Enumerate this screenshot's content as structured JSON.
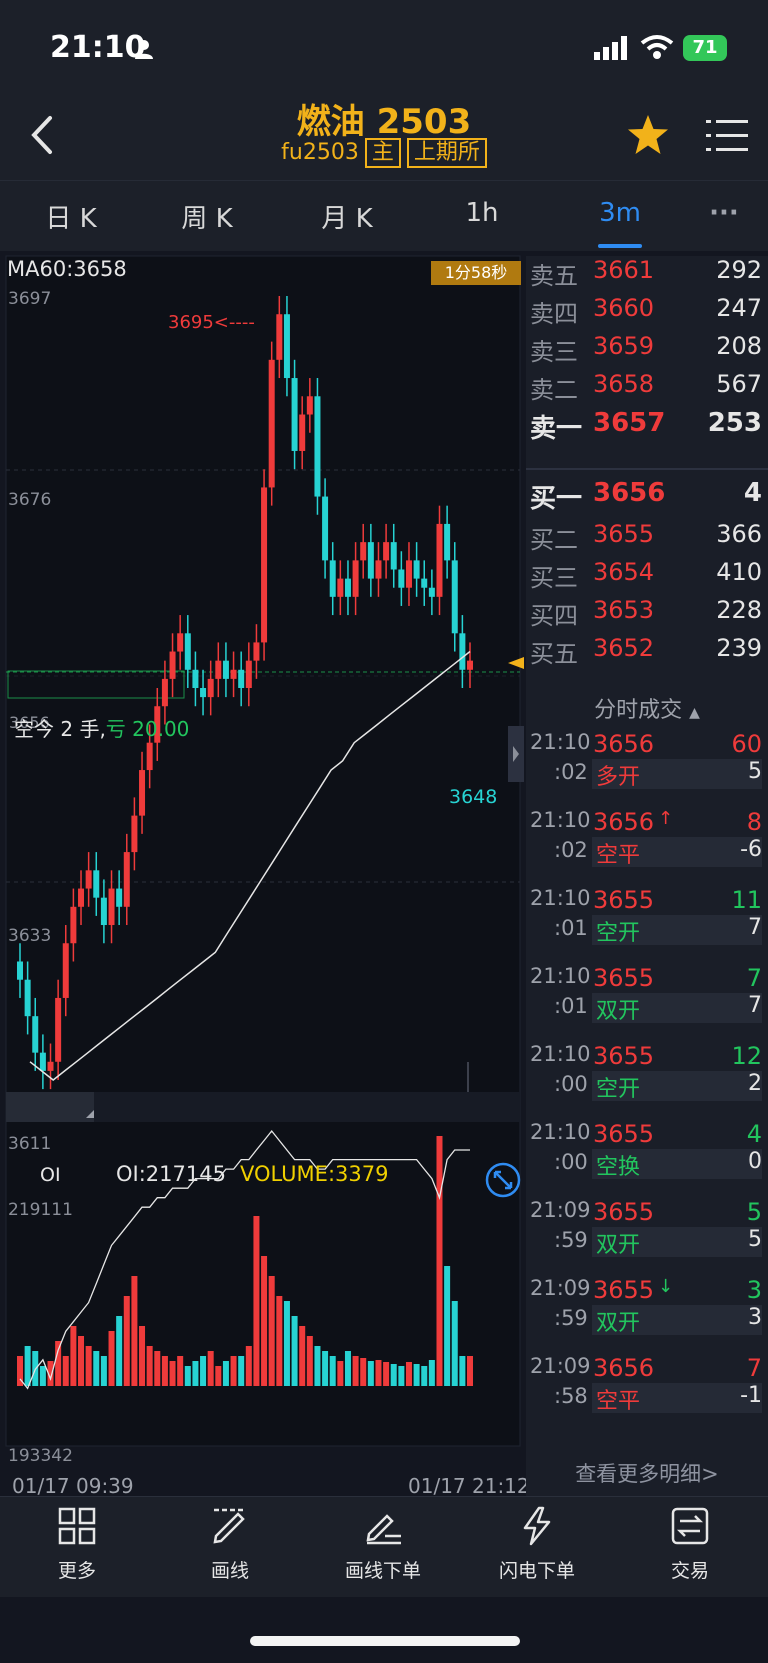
{
  "status": {
    "time": "21:10",
    "battery": "71"
  },
  "header": {
    "title": "燃油 2503",
    "code": "fu2503",
    "tag_main": "主",
    "tag_exchange": "上期所"
  },
  "tabs": [
    {
      "label": "日 K",
      "active": false
    },
    {
      "label": "周 K",
      "active": false
    },
    {
      "label": "月 K",
      "active": false
    },
    {
      "label": "1h",
      "active": false
    },
    {
      "label": "3m",
      "active": true
    },
    {
      "label": "···",
      "active": false
    }
  ],
  "chart": {
    "ma_label": "MA60:3658",
    "countdown": "1分58秒",
    "axis_labels": [
      "3697",
      "3676",
      "3633",
      "3611"
    ],
    "max_marker": "3695<----",
    "min_marker": "3648",
    "position_label": "空今 2 手,",
    "position_pnl": "亏 20.00",
    "position_price": "3656",
    "indicator_tab": "OI",
    "oi_value": "OI:217145",
    "volume_value": "VOLUME:3379",
    "sub_axis_top": "219111",
    "sub_axis_bottom": "193342",
    "date_start": "01/17 09:39",
    "date_end": "01/17 21:12"
  },
  "chart_data": {
    "type": "candlestick",
    "ma_period": 60,
    "ma_value": 3658,
    "y_ticks": [
      3697,
      3676,
      3633,
      3611
    ],
    "high": 3695,
    "low": 3648,
    "last": 3656,
    "oi": 217145,
    "volume": 3379,
    "oi_range": [
      193342,
      219111
    ]
  },
  "orderbook": {
    "asks": [
      {
        "label": "卖五",
        "price": "3661",
        "vol": "292"
      },
      {
        "label": "卖四",
        "price": "3660",
        "vol": "247"
      },
      {
        "label": "卖三",
        "price": "3659",
        "vol": "208"
      },
      {
        "label": "卖二",
        "price": "3658",
        "vol": "567"
      },
      {
        "label": "卖一",
        "price": "3657",
        "vol": "253"
      }
    ],
    "bids": [
      {
        "label": "买一",
        "price": "3656",
        "vol": "4"
      },
      {
        "label": "买二",
        "price": "3655",
        "vol": "366"
      },
      {
        "label": "买三",
        "price": "3654",
        "vol": "410"
      },
      {
        "label": "买四",
        "price": "3653",
        "vol": "228"
      },
      {
        "label": "买五",
        "price": "3652",
        "vol": "239"
      }
    ]
  },
  "ticks_header": "分时成交",
  "ticks": [
    {
      "time": "21:10",
      "sec": ":02",
      "price": "3656",
      "arrow": "",
      "vol": "60",
      "vol_color": "#ef3b3b",
      "type": "多开",
      "type_color": "#ef3b3b",
      "chg": "5"
    },
    {
      "time": "21:10",
      "sec": ":02",
      "price": "3656",
      "arrow": "↑",
      "vol": "8",
      "vol_color": "#ef3b3b",
      "type": "空平",
      "type_color": "#ef3b3b",
      "chg": "-6"
    },
    {
      "time": "21:10",
      "sec": ":01",
      "price": "3655",
      "arrow": "",
      "vol": "11",
      "vol_color": "#22c55e",
      "type": "空开",
      "type_color": "#22c55e",
      "chg": "7"
    },
    {
      "time": "21:10",
      "sec": ":01",
      "price": "3655",
      "arrow": "",
      "vol": "7",
      "vol_color": "#22c55e",
      "type": "双开",
      "type_color": "#22c55e",
      "chg": "7"
    },
    {
      "time": "21:10",
      "sec": ":00",
      "price": "3655",
      "arrow": "",
      "vol": "12",
      "vol_color": "#22c55e",
      "type": "空开",
      "type_color": "#22c55e",
      "chg": "2"
    },
    {
      "time": "21:10",
      "sec": ":00",
      "price": "3655",
      "arrow": "",
      "vol": "4",
      "vol_color": "#22c55e",
      "type": "空换",
      "type_color": "#22c55e",
      "chg": "0"
    },
    {
      "time": "21:09",
      "sec": ":59",
      "price": "3655",
      "arrow": "",
      "vol": "5",
      "vol_color": "#22c55e",
      "type": "双开",
      "type_color": "#22c55e",
      "chg": "5"
    },
    {
      "time": "21:09",
      "sec": ":59",
      "price": "3655",
      "arrow": "↓",
      "vol": "3",
      "vol_color": "#22c55e",
      "type": "双开",
      "type_color": "#22c55e",
      "chg": "3"
    },
    {
      "time": "21:09",
      "sec": ":58",
      "price": "3656",
      "arrow": "",
      "vol": "7",
      "vol_color": "#ef3b3b",
      "type": "空平",
      "type_color": "#ef3b3b",
      "chg": "-1"
    }
  ],
  "more_link": "查看更多明细>",
  "toolbar": [
    {
      "label": "更多",
      "icon": "grid-icon"
    },
    {
      "label": "画线",
      "icon": "draw-line-icon"
    },
    {
      "label": "画线下单",
      "icon": "draw-order-icon"
    },
    {
      "label": "闪电下单",
      "icon": "lightning-icon"
    },
    {
      "label": "交易",
      "icon": "trade-icon"
    }
  ],
  "colors": {
    "up": "#ef3b3b",
    "down": "#27d3d3",
    "accent": "#f2b21a",
    "active_tab": "#2f8cf2"
  }
}
